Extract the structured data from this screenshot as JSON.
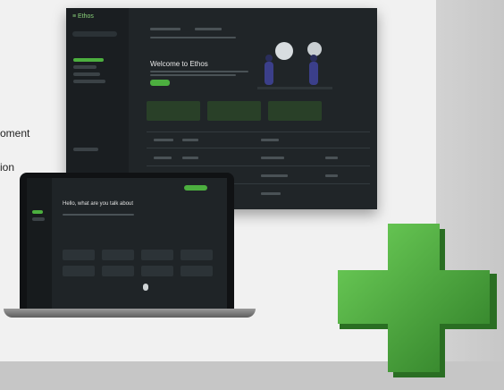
{
  "side_texts": [
    "oment",
    "ion"
  ],
  "dashboard": {
    "logo": "≡ Ethos",
    "welcome": "Welcome to Ethos",
    "cta": ""
  },
  "laptop": {
    "heading": "Hello, what are you talk about"
  },
  "colors": {
    "accent": "#4caf3f",
    "dark": "#202528",
    "cross": "#3f9c35"
  }
}
